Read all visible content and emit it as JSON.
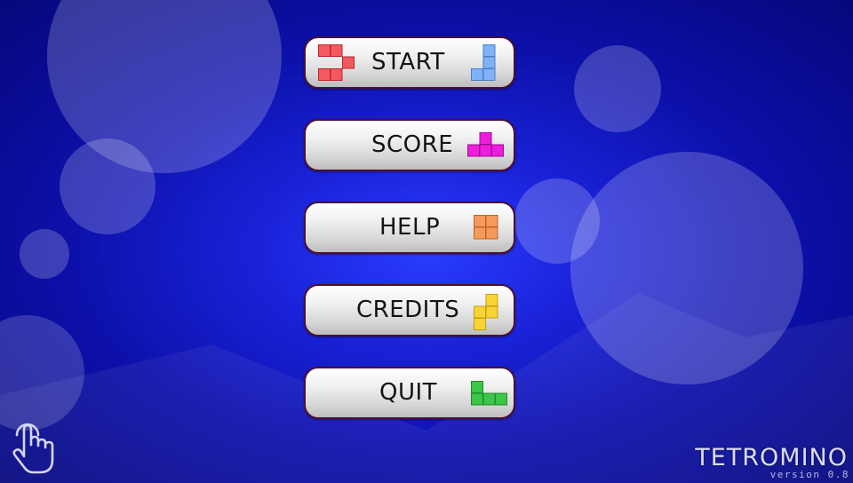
{
  "menu": {
    "items": [
      {
        "id": "start",
        "label": "START",
        "pieces": [
          {
            "name": "z-tetromino-icon",
            "color": "#f25a5f"
          },
          {
            "name": "j-tetromino-icon",
            "color": "#7fb2f7"
          }
        ]
      },
      {
        "id": "score",
        "label": "SCORE",
        "pieces": [
          {
            "name": "t-tetromino-icon",
            "color": "#ee1ddd"
          }
        ]
      },
      {
        "id": "help",
        "label": "HELP",
        "pieces": [
          {
            "name": "o-tetromino-icon",
            "color": "#f59a5b"
          }
        ]
      },
      {
        "id": "credits",
        "label": "CREDITS",
        "pieces": [
          {
            "name": "s-tetromino-icon",
            "color": "#f8d534"
          }
        ]
      },
      {
        "id": "quit",
        "label": "QUIT",
        "pieces": [
          {
            "name": "l-tetromino-icon",
            "color": "#3bc647"
          }
        ]
      }
    ]
  },
  "footer": {
    "title": "TETROMINO",
    "version": "version 0.8"
  },
  "touch_icon": "touch-hand-icon",
  "colors": {
    "background_center": "#2a3cff",
    "background_edge": "#05077a",
    "button_border": "#4a1030"
  }
}
